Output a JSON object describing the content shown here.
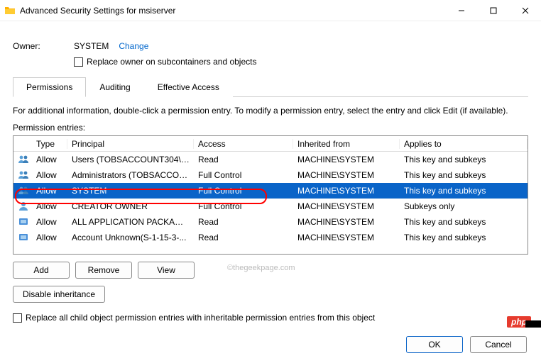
{
  "window": {
    "title": "Advanced Security Settings for msiserver"
  },
  "owner": {
    "label": "Owner:",
    "value": "SYSTEM",
    "change_link": "Change",
    "replace_checkbox_label": "Replace owner on subcontainers and objects"
  },
  "tabs": {
    "permissions": "Permissions",
    "auditing": "Auditing",
    "effective": "Effective Access"
  },
  "info_text": "For additional information, double-click a permission entry. To modify a permission entry, select the entry and click Edit (if available).",
  "entries_label": "Permission entries:",
  "columns": {
    "type": "Type",
    "principal": "Principal",
    "access": "Access",
    "inherited": "Inherited from",
    "applies": "Applies to"
  },
  "rows": [
    {
      "type": "Allow",
      "principal": "Users (TOBSACCOUNT304\\Us...",
      "access": "Read",
      "inherited": "MACHINE\\SYSTEM",
      "applies": "This key and subkeys",
      "icon": "users"
    },
    {
      "type": "Allow",
      "principal": "Administrators (TOBSACCOU...",
      "access": "Full Control",
      "inherited": "MACHINE\\SYSTEM",
      "applies": "This key and subkeys",
      "icon": "users"
    },
    {
      "type": "Allow",
      "principal": "SYSTEM",
      "access": "Full Control",
      "inherited": "MACHINE\\SYSTEM",
      "applies": "This key and subkeys",
      "icon": "users",
      "selected": true
    },
    {
      "type": "Allow",
      "principal": "CREATOR OWNER",
      "access": "Full Control",
      "inherited": "MACHINE\\SYSTEM",
      "applies": "Subkeys only",
      "icon": "user"
    },
    {
      "type": "Allow",
      "principal": "ALL APPLICATION PACKAGES",
      "access": "Read",
      "inherited": "MACHINE\\SYSTEM",
      "applies": "This key and subkeys",
      "icon": "app"
    },
    {
      "type": "Allow",
      "principal": "Account Unknown(S-1-15-3-...",
      "access": "Read",
      "inherited": "MACHINE\\SYSTEM",
      "applies": "This key and subkeys",
      "icon": "app"
    }
  ],
  "buttons": {
    "add": "Add",
    "remove": "Remove",
    "view": "View",
    "disable_inherit": "Disable inheritance",
    "ok": "OK",
    "cancel": "Cancel"
  },
  "replace_all_label": "Replace all child object permission entries with inheritable permission entries from this object",
  "watermark": "©thegeekpage.com",
  "badge": "php"
}
